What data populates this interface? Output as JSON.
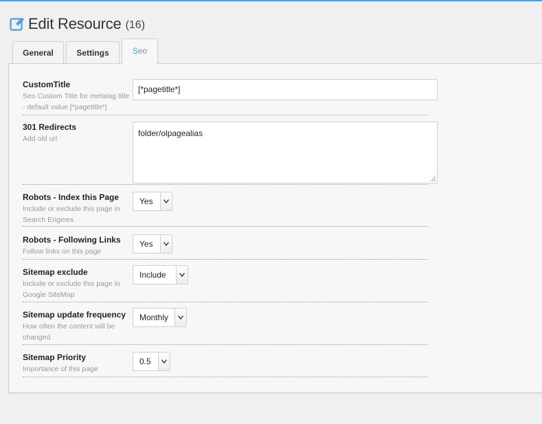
{
  "header": {
    "title": "Edit Resource",
    "count": "(16)",
    "icon": "edit-icon"
  },
  "tabs": [
    {
      "label": "General",
      "active": false
    },
    {
      "label": "Settings",
      "active": false
    },
    {
      "label": "Seo",
      "active": true
    }
  ],
  "colors": {
    "accent": "#4a9fd8"
  },
  "fields": {
    "custom_title": {
      "label": "CustomTitle",
      "description": "Seo Custom Title for metatag title - default value [*pagetitle*]",
      "value": "[*pagetitle*]"
    },
    "redirects": {
      "label": "301 Redirects",
      "description": "Add old url",
      "value": "folder/olpagealias"
    },
    "robots_index": {
      "label": "Robots - Index this Page",
      "description": "Include or exclude this page in Search Engines",
      "value": "Yes"
    },
    "robots_follow": {
      "label": "Robots - Following Links",
      "description": "Follow links on this page",
      "value": "Yes"
    },
    "sitemap_exclude": {
      "label": "Sitemap exclude",
      "description": "Include or exclude this page in Google SiteMap",
      "value": "Include"
    },
    "sitemap_frequency": {
      "label": "Sitemap update frequency",
      "description": "How often the content will be changed",
      "value": "Monthly"
    },
    "sitemap_priority": {
      "label": "Sitemap Priority",
      "description": "Importance of this page",
      "value": "0.5"
    }
  }
}
